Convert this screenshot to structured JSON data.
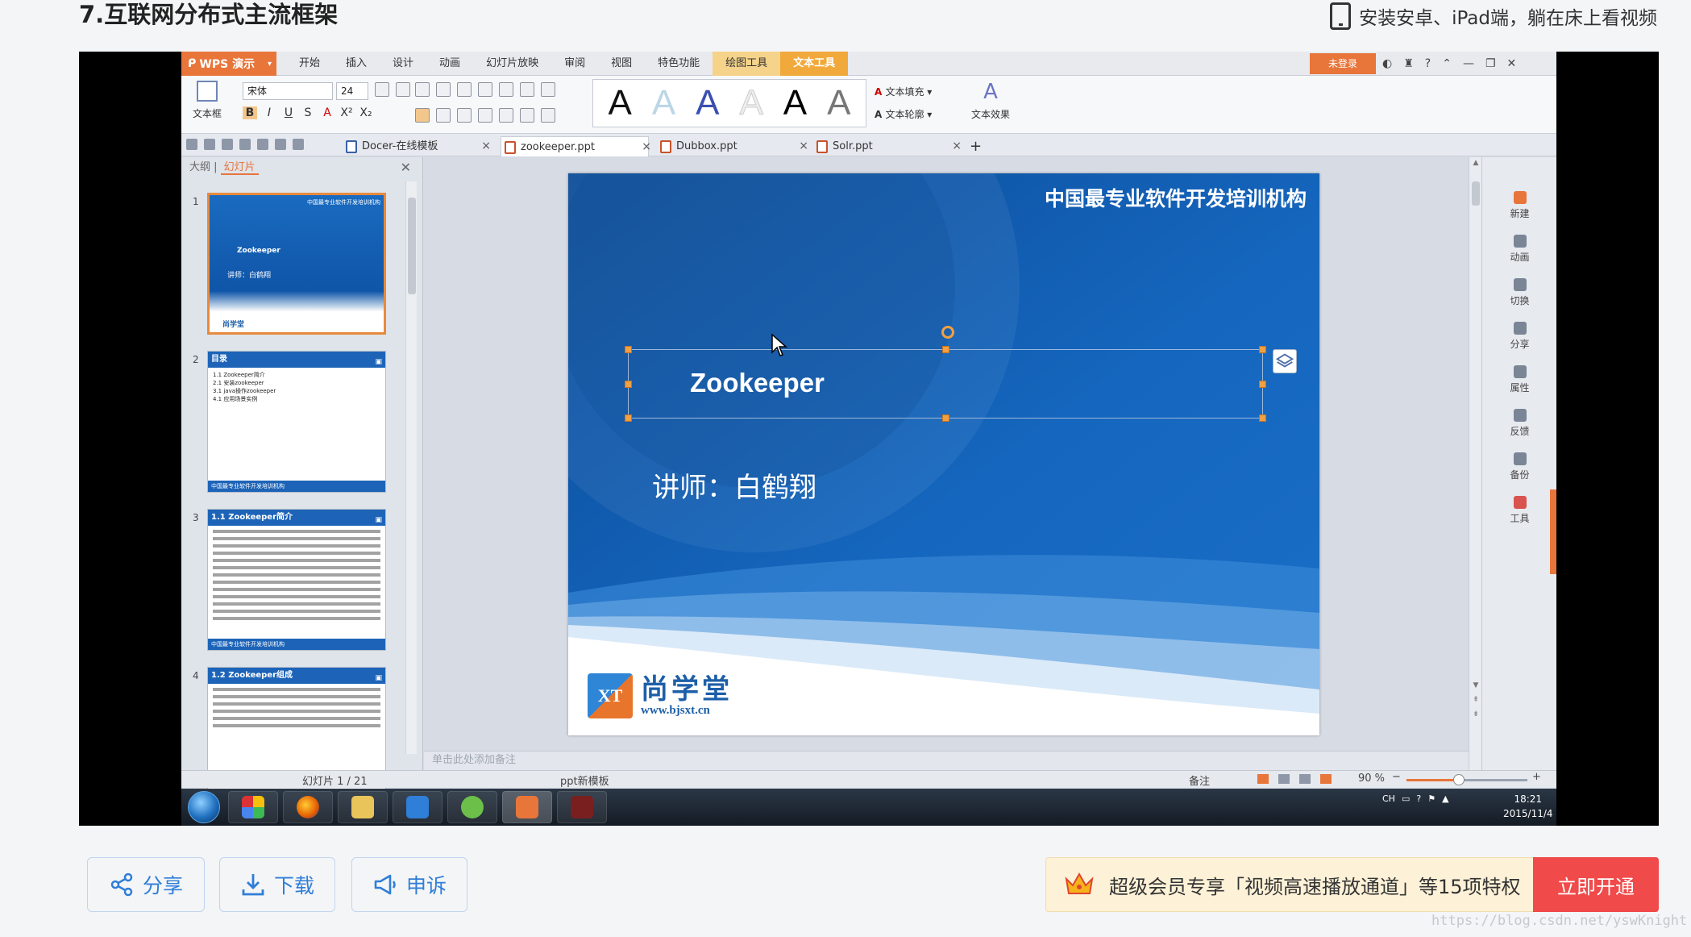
{
  "page": {
    "title": "7.互联网分布式主流框架",
    "app_promo": "安装安卓、iPad端，躺在床上看视频"
  },
  "wps": {
    "app_name": "WPS 演示",
    "ribbon_tabs": [
      "开始",
      "插入",
      "设计",
      "动画",
      "幻灯片放映",
      "审阅",
      "视图",
      "特色功能",
      "绘图工具",
      "文本工具"
    ],
    "login_label": "未登录",
    "textbox_label": "文本框",
    "font_name": "宋体",
    "font_size": "24",
    "format_buttons": [
      "B",
      "I",
      "U",
      "S",
      "A",
      "X²",
      "X₂"
    ],
    "gallery_letters": [
      "A",
      "A",
      "A",
      "A",
      "A",
      "A"
    ],
    "text_fill": "文本填充",
    "text_outline": "文本轮廓",
    "text_effect": "文本效果",
    "doc_tabs": [
      {
        "label": "Docer-在线模板"
      },
      {
        "label": "zookeeper.ppt"
      },
      {
        "label": "Dubbox.ppt"
      },
      {
        "label": "Solr.ppt"
      }
    ],
    "panel_tabs": {
      "outline": "大纲",
      "slides": "幻灯片"
    },
    "thumbnails": [
      {
        "num": "1",
        "org": "中国最专业软件开发培训机构",
        "title": "Zookeeper",
        "lecturer": "讲师：白鹤翔",
        "logo": "尚学堂"
      },
      {
        "num": "2",
        "header": "目录",
        "lines": [
          "1.1 Zookeeper简介",
          "2.1 安装zookeeper",
          "3.1 java操作zookeeper",
          "4.1 应用场景实例"
        ],
        "footer": "中国最专业软件开发培训机构"
      },
      {
        "num": "3",
        "header": "1.1 Zookeeper简介",
        "footer": "中国最专业软件开发培训机构"
      },
      {
        "num": "4",
        "header": "1.2 Zookeeper组成"
      }
    ],
    "slide": {
      "org": "中国最专业软件开发培训机构",
      "title": "Zookeeper",
      "lecturer": "讲师：白鹤翔",
      "logo_cn": "尚学堂",
      "logo_url": "www.bjsxt.cn"
    },
    "notes_placeholder": "单击此处添加备注",
    "right_panel": [
      "新建",
      "动画",
      "切换",
      "分享",
      "属性",
      "反馈",
      "备份",
      "工具"
    ],
    "status": {
      "slide_counter": "幻灯片 1 / 21",
      "template": "ppt新模板",
      "notes": "备注",
      "zoom": "90 %",
      "zoom_fraction": 0.43
    },
    "taskbar": {
      "tray_lang": "CH",
      "time": "18:21",
      "date": "2015/11/4"
    }
  },
  "actions": {
    "share": "分享",
    "download": "下载",
    "report": "申诉"
  },
  "vip": {
    "text": "超级会员专享「视频高速播放通道」等15项特权",
    "open": "立即开通"
  },
  "watermark": "https://blog.csdn.net/yswKnight",
  "colors": {
    "wps_orange": "#e8753a",
    "slide_blue": "#0f5cb0",
    "link_blue": "#2f7ed8",
    "vip_red": "#f04a4a"
  }
}
